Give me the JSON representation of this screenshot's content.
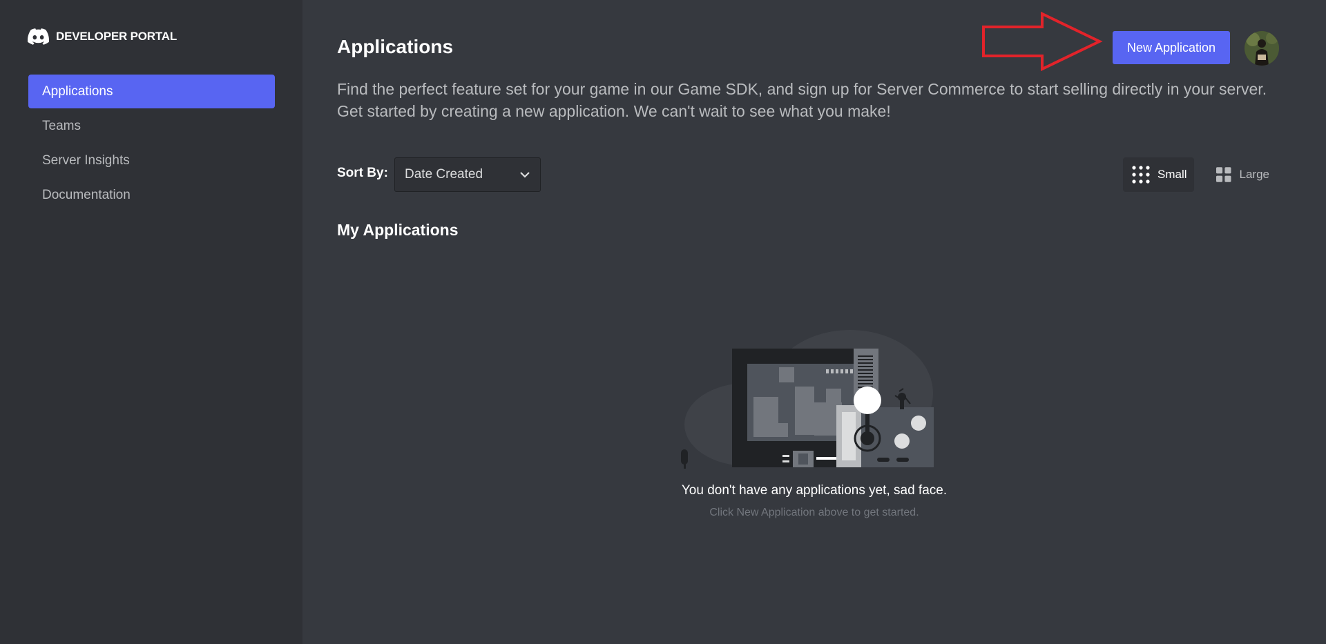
{
  "brand": {
    "logo_icon": "discord-logo-icon",
    "title": "DEVELOPER PORTAL"
  },
  "sidebar": {
    "items": [
      {
        "label": "Applications",
        "active": true
      },
      {
        "label": "Teams",
        "active": false
      },
      {
        "label": "Server Insights",
        "active": false
      },
      {
        "label": "Documentation",
        "active": false
      }
    ]
  },
  "header": {
    "title": "Applications",
    "new_app_label": "New Application",
    "description": "Find the perfect feature set for your game in our Game SDK, and sign up for Server Commerce to start selling directly in your server. Get started by creating a new application. We can't wait to see what you make!"
  },
  "sort": {
    "label": "Sort By:",
    "selected": "Date Created"
  },
  "view_toggle": {
    "small_label": "Small",
    "large_label": "Large",
    "active": "Small"
  },
  "section": {
    "title": "My Applications"
  },
  "empty_state": {
    "title": "You don't have any applications yet, sad face.",
    "subtitle": "Click New Application above to get started."
  },
  "colors": {
    "accent": "#5865f2",
    "sidebar_bg": "#2f3136",
    "main_bg": "#36393f",
    "annotation_arrow": "#e2232a"
  }
}
